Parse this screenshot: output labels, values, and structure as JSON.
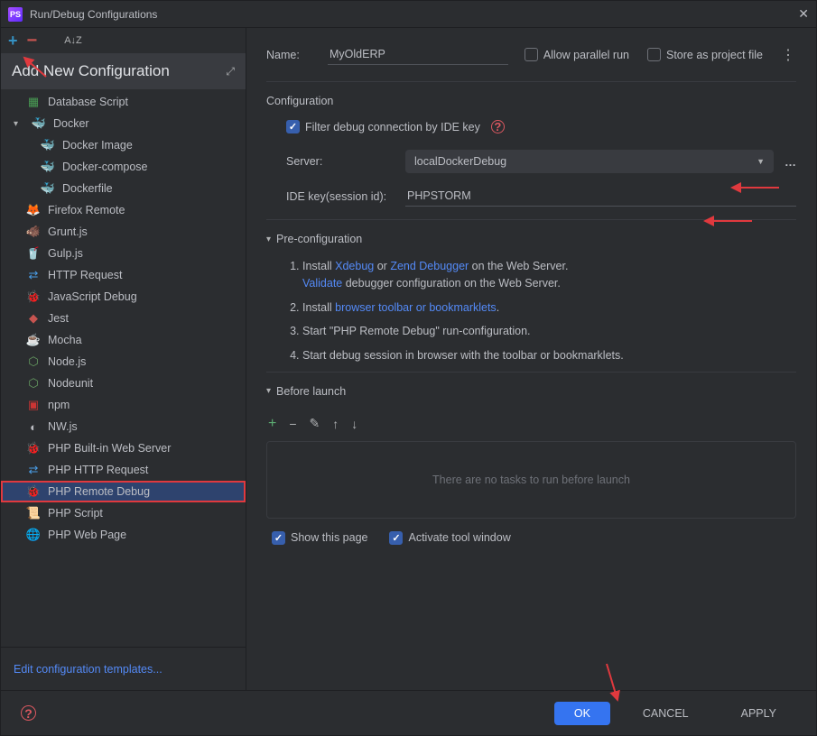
{
  "window": {
    "title": "Run/Debug Configurations",
    "addnew_title": "Add New Configuration"
  },
  "tree": {
    "items": [
      {
        "label": "Database Script",
        "icon": "db"
      },
      {
        "label": "Docker",
        "icon": "docker",
        "expandable": true,
        "expanded": true
      },
      {
        "label": "Docker Image",
        "icon": "docker",
        "level": 1
      },
      {
        "label": "Docker-compose",
        "icon": "docker",
        "level": 1
      },
      {
        "label": "Dockerfile",
        "icon": "docker",
        "level": 1
      },
      {
        "label": "Firefox Remote",
        "icon": "firefox"
      },
      {
        "label": "Grunt.js",
        "icon": "grunt"
      },
      {
        "label": "Gulp.js",
        "icon": "gulp"
      },
      {
        "label": "HTTP Request",
        "icon": "http"
      },
      {
        "label": "JavaScript Debug",
        "icon": "js"
      },
      {
        "label": "Jest",
        "icon": "jest"
      },
      {
        "label": "Mocha",
        "icon": "mocha"
      },
      {
        "label": "Node.js",
        "icon": "node"
      },
      {
        "label": "Nodeunit",
        "icon": "node"
      },
      {
        "label": "npm",
        "icon": "npm"
      },
      {
        "label": "NW.js",
        "icon": "nw"
      },
      {
        "label": "PHP Built-in Web Server",
        "icon": "php"
      },
      {
        "label": "PHP HTTP Request",
        "icon": "http"
      },
      {
        "label": "PHP Remote Debug",
        "icon": "php",
        "selected": true,
        "highlighted": true
      },
      {
        "label": "PHP Script",
        "icon": "script"
      },
      {
        "label": "PHP Web Page",
        "icon": "web"
      }
    ]
  },
  "edit_templates": "Edit configuration templates...",
  "form": {
    "name_label": "Name:",
    "name_value": "MyOldERP",
    "allow_parallel": "Allow parallel run",
    "store_project": "Store as project file",
    "config_section": "Configuration",
    "filter_debug": "Filter debug connection by IDE key",
    "server_label": "Server:",
    "server_value": "localDockerDebug",
    "ide_label": "IDE key(session id):",
    "ide_value": "PHPSTORM",
    "preconfig_title": "Pre-configuration",
    "preconfig": {
      "l1_a": "Install ",
      "l1_xdebug": "Xdebug",
      "l1_b": " or ",
      "l1_zend": "Zend Debugger",
      "l1_c": " on the Web Server.",
      "l1_validate": "Validate",
      "l1_d": " debugger configuration on the Web Server.",
      "l2_a": "Install ",
      "l2_link": "browser toolbar or bookmarklets",
      "l2_b": ".",
      "l3": "Start \"PHP Remote Debug\" run-configuration.",
      "l4": "Start debug session in browser with the toolbar or bookmarklets."
    },
    "before_launch": "Before launch",
    "no_tasks": "There are no tasks to run before launch",
    "show_page": "Show this page",
    "activate_tool": "Activate tool window"
  },
  "buttons": {
    "ok": "OK",
    "cancel": "CANCEL",
    "apply": "APPLY"
  }
}
